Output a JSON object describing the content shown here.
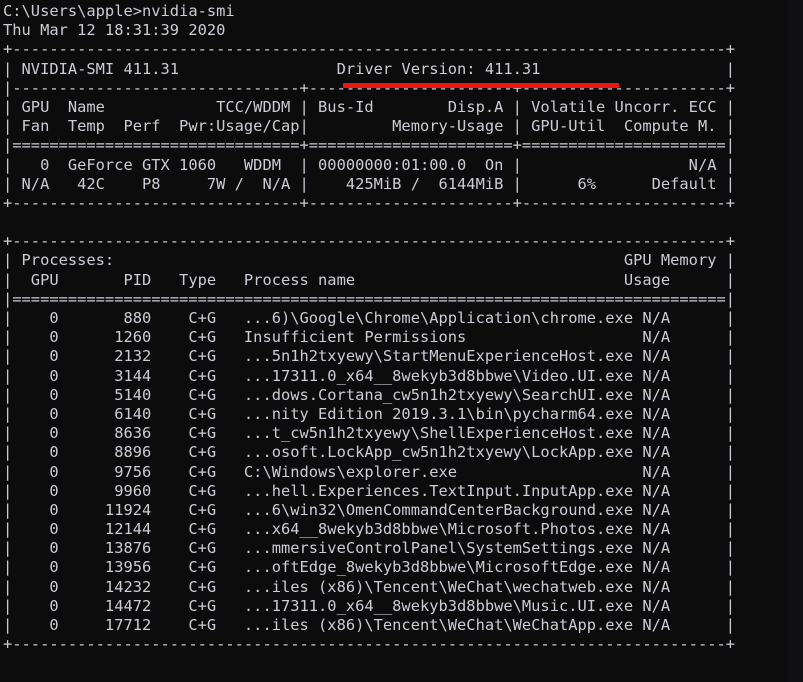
{
  "terminal": {
    "background_color": "#0c0c0c",
    "text_color": "#ccccd6",
    "annotation_color": "#f21313",
    "prompt_line": "C:\\Users\\apple>nvidia-smi",
    "timestamp_line": "Thu Mar 12 18:31:39 2020"
  },
  "annotation": {
    "name": "driver-version-underline",
    "target_text": "Driver Version: 411.31",
    "color": "#f21313"
  },
  "smi_header": {
    "tool_label": "NVIDIA-SMI",
    "tool_version": "411.31",
    "driver_label": "Driver Version:",
    "driver_version": "411.31"
  },
  "gpu_table": {
    "header_row_1": [
      "GPU",
      "Name",
      "TCC/WDDM",
      "Bus-Id",
      "Disp.A",
      "Volatile Uncorr. ECC"
    ],
    "header_row_2": [
      "Fan",
      "Temp",
      "Perf",
      "Pwr:Usage/Cap",
      "Memory-Usage",
      "GPU-Util",
      "Compute M."
    ],
    "rows": [
      {
        "gpu": "0",
        "name": "GeForce GTX 1060",
        "tcc_wddm": "WDDM",
        "bus_id": "00000000:01:00.0",
        "disp_a": "On",
        "ecc": "N/A",
        "fan": "N/A",
        "temp": "42C",
        "perf": "P8",
        "pwr_usage_cap": "7W /  N/A",
        "memory_usage": "425MiB /  6144MiB",
        "gpu_util": "6%",
        "compute_m": "Default"
      }
    ]
  },
  "processes_table": {
    "section_label": "Processes:",
    "memory_label_line_1": "GPU Memory",
    "memory_label_line_2": "Usage",
    "headers": [
      "GPU",
      "PID",
      "Type",
      "Process name"
    ],
    "rows": [
      {
        "gpu": "0",
        "pid": "880",
        "type": "C+G",
        "name": "...6)\\Google\\Chrome\\Application\\chrome.exe",
        "usage": "N/A"
      },
      {
        "gpu": "0",
        "pid": "1260",
        "type": "C+G",
        "name": "Insufficient Permissions",
        "usage": "N/A"
      },
      {
        "gpu": "0",
        "pid": "2132",
        "type": "C+G",
        "name": "...5n1h2txyewy\\StartMenuExperienceHost.exe",
        "usage": "N/A"
      },
      {
        "gpu": "0",
        "pid": "3144",
        "type": "C+G",
        "name": "...17311.0_x64__8wekyb3d8bbwe\\Video.UI.exe",
        "usage": "N/A"
      },
      {
        "gpu": "0",
        "pid": "5140",
        "type": "C+G",
        "name": "...dows.Cortana_cw5n1h2txyewy\\SearchUI.exe",
        "usage": "N/A"
      },
      {
        "gpu": "0",
        "pid": "6140",
        "type": "C+G",
        "name": "...nity Edition 2019.3.1\\bin\\pycharm64.exe",
        "usage": "N/A"
      },
      {
        "gpu": "0",
        "pid": "8636",
        "type": "C+G",
        "name": "...t_cw5n1h2txyewy\\ShellExperienceHost.exe",
        "usage": "N/A"
      },
      {
        "gpu": "0",
        "pid": "8896",
        "type": "C+G",
        "name": "...osoft.LockApp_cw5n1h2txyewy\\LockApp.exe",
        "usage": "N/A"
      },
      {
        "gpu": "0",
        "pid": "9756",
        "type": "C+G",
        "name": "C:\\Windows\\explorer.exe",
        "usage": "N/A"
      },
      {
        "gpu": "0",
        "pid": "9960",
        "type": "C+G",
        "name": "...hell.Experiences.TextInput.InputApp.exe",
        "usage": "N/A"
      },
      {
        "gpu": "0",
        "pid": "11924",
        "type": "C+G",
        "name": "...6\\win32\\OmenCommandCenterBackground.exe",
        "usage": "N/A"
      },
      {
        "gpu": "0",
        "pid": "12144",
        "type": "C+G",
        "name": "...x64__8wekyb3d8bbwe\\Microsoft.Photos.exe",
        "usage": "N/A"
      },
      {
        "gpu": "0",
        "pid": "13876",
        "type": "C+G",
        "name": "...mmersiveControlPanel\\SystemSettings.exe",
        "usage": "N/A"
      },
      {
        "gpu": "0",
        "pid": "13956",
        "type": "C+G",
        "name": "...oftEdge_8wekyb3d8bbwe\\MicrosoftEdge.exe",
        "usage": "N/A"
      },
      {
        "gpu": "0",
        "pid": "14232",
        "type": "C+G",
        "name": "...iles (x86)\\Tencent\\WeChat\\wechatweb.exe",
        "usage": "N/A"
      },
      {
        "gpu": "0",
        "pid": "14472",
        "type": "C+G",
        "name": "...17311.0_x64__8wekyb3d8bbwe\\Music.UI.exe",
        "usage": "N/A"
      },
      {
        "gpu": "0",
        "pid": "17712",
        "type": "C+G",
        "name": "...iles (x86)\\Tencent\\WeChat\\WeChatApp.exe",
        "usage": "N/A"
      }
    ]
  },
  "raw_lines": [
    "C:\\Users\\apple>nvidia-smi",
    "Thu Mar 12 18:31:39 2020",
    "+-----------------------------------------------------------------------------+",
    "| NVIDIA-SMI 411.31                 Driver Version: 411.31                    |",
    "|-------------------------------+----------------------+----------------------+",
    "| GPU  Name            TCC/WDDM | Bus-Id        Disp.A | Volatile Uncorr. ECC |",
    "| Fan  Temp  Perf  Pwr:Usage/Cap|         Memory-Usage | GPU-Util  Compute M. |",
    "|===============================+======================+======================|",
    "|   0  GeForce GTX 1060   WDDM  | 00000000:01:00.0  On |                  N/A |",
    "| N/A   42C    P8     7W /  N/A |    425MiB /  6144MiB |      6%      Default |",
    "+-------------------------------+----------------------+----------------------+",
    "",
    "+-----------------------------------------------------------------------------+",
    "| Processes:                                                       GPU Memory |",
    "|  GPU       PID   Type   Process name                             Usage      |",
    "|=============================================================================|",
    "|    0       880    C+G   ...6)\\Google\\Chrome\\Application\\chrome.exe N/A      |",
    "|    0      1260    C+G   Insufficient Permissions                   N/A      |",
    "|    0      2132    C+G   ...5n1h2txyewy\\StartMenuExperienceHost.exe N/A      |",
    "|    0      3144    C+G   ...17311.0_x64__8wekyb3d8bbwe\\Video.UI.exe N/A      |",
    "|    0      5140    C+G   ...dows.Cortana_cw5n1h2txyewy\\SearchUI.exe N/A      |",
    "|    0      6140    C+G   ...nity Edition 2019.3.1\\bin\\pycharm64.exe N/A      |",
    "|    0      8636    C+G   ...t_cw5n1h2txyewy\\ShellExperienceHost.exe N/A      |",
    "|    0      8896    C+G   ...osoft.LockApp_cw5n1h2txyewy\\LockApp.exe N/A      |",
    "|    0      9756    C+G   C:\\Windows\\explorer.exe                    N/A      |",
    "|    0      9960    C+G   ...hell.Experiences.TextInput.InputApp.exe N/A      |",
    "|    0     11924    C+G   ...6\\win32\\OmenCommandCenterBackground.exe N/A      |",
    "|    0     12144    C+G   ...x64__8wekyb3d8bbwe\\Microsoft.Photos.exe N/A      |",
    "|    0     13876    C+G   ...mmersiveControlPanel\\SystemSettings.exe N/A      |",
    "|    0     13956    C+G   ...oftEdge_8wekyb3d8bbwe\\MicrosoftEdge.exe N/A      |",
    "|    0     14232    C+G   ...iles (x86)\\Tencent\\WeChat\\wechatweb.exe N/A      |",
    "|    0     14472    C+G   ...17311.0_x64__8wekyb3d8bbwe\\Music.UI.exe N/A      |",
    "|    0     17712    C+G   ...iles (x86)\\Tencent\\WeChat\\WeChatApp.exe N/A      |",
    "+-----------------------------------------------------------------------------+"
  ]
}
